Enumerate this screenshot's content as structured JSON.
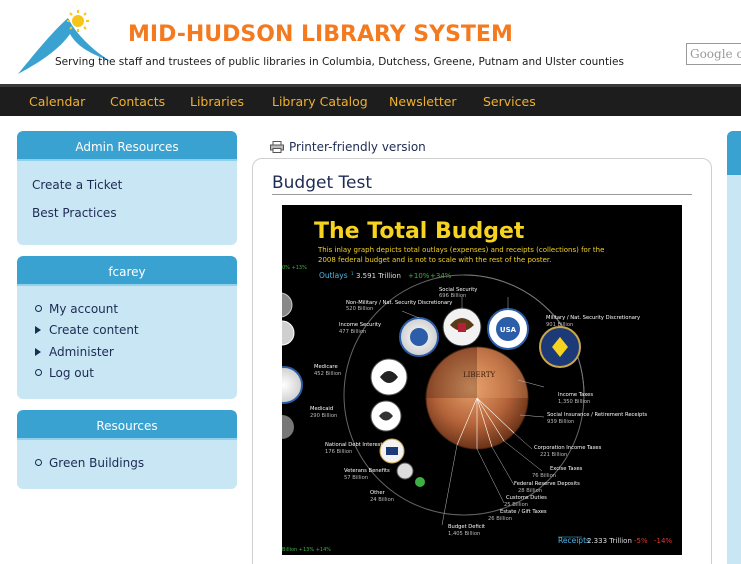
{
  "header": {
    "site_name": "MID-HUDSON LIBRARY SYSTEM",
    "slogan": "Serving the staff and trustees of public libraries in Columbia, Dutchess, Greene, Putnam and Ulster counties",
    "search_placeholder": "Google c",
    "logo_icon": "mountain-sun-logo"
  },
  "nav": {
    "items": [
      "Calendar",
      "Contacts",
      "Libraries",
      "Library Catalog",
      "Newsletter",
      "Services"
    ]
  },
  "sidebar": {
    "admin": {
      "title": "Admin Resources",
      "links": [
        "Create a Ticket",
        "Best Practices"
      ]
    },
    "user": {
      "title": "fcarey",
      "items": [
        "My account",
        "Create content",
        "Administer",
        "Log out"
      ]
    },
    "resources": {
      "title": "Resources",
      "items": [
        "Green Buildings"
      ]
    }
  },
  "content": {
    "printer_label": "Printer-friendly version",
    "title": "Budget Test",
    "infographic": {
      "heading": "The Total Budget",
      "intro_1": "This inlay graph depicts total outlays (expenses) and receipts (collections) for the",
      "intro_2": "2008 federal budget and is not to scale with the rest of the poster.",
      "outlays": {
        "label": "Outlays",
        "sup": "1",
        "amount": "3.591 Trillion",
        "change1": "+10%",
        "change2": "+34%"
      },
      "receipts": {
        "label": "Receipts",
        "amount": "2.333 Trillion",
        "change1": "-5%",
        "change2": "-14%"
      },
      "left_categories": [
        {
          "name": "Social Security",
          "sup": "2",
          "detail": "696 Billion",
          "ch": "+7% +10%"
        },
        {
          "name": "Non-Military / Nat. Security Discretionary",
          "detail": "520 Billion",
          "ch": "+6% +65%"
        },
        {
          "name": "Income Security",
          "detail": "477 Billion",
          "ch": "+14% +21%"
        },
        {
          "name": "Medicare",
          "detail": "452 Billion",
          "ch": "+8% +10%"
        },
        {
          "name": "Medicaid",
          "detail": "290 Billion",
          "ch": "+22% +80%"
        },
        {
          "name": "National Debt Interest",
          "detail": "176 Billion",
          "ch": "-15% -34%"
        },
        {
          "name": "Veterans Benefits",
          "detail": "57 Billion",
          "ch": "+13% +7%"
        },
        {
          "name": "Other",
          "detail": "24 Billion",
          "ch": ""
        },
        {
          "name": "Budget Deficit",
          "sup": "3",
          "detail": "1,405 Billion",
          "ch": "+109% +352%"
        }
      ],
      "right_categories": [
        {
          "name": "Military / Nat. Security Discretionary",
          "detail": "901 Billion",
          "ch": "+1% +1%"
        },
        {
          "name": "Income Taxes",
          "detail": "1,350 Billion",
          "ch": "-4% -4%"
        },
        {
          "name": "Social Insurance / Retirement Receipts",
          "detail": "939 Billion",
          "ch": "+2% +0%"
        },
        {
          "name": "Corporation Income Taxes",
          "detail": "221 Billion",
          "ch": "-14% -42%"
        },
        {
          "name": "Excise Taxes",
          "detail": "76 Billion",
          "ch": "+7% -1%"
        },
        {
          "name": "Federal Reserve Deposits",
          "detail": "28 Billion",
          "ch": "-9% -26%"
        },
        {
          "name": "Customs Duties",
          "detail": "25 Billion",
          "ch": "-5% -14%"
        },
        {
          "name": "Estate / Gift Taxes",
          "detail": "26 Billion",
          "ch": "-15% -10%"
        }
      ],
      "left_edge_text_top": "0% +13%",
      "left_edge_text_bottom": "Billion +13% +14%",
      "colors": {
        "heading": "#f5d320",
        "positive": "#3cb043",
        "negative": "#e23b2e",
        "outlays": "#4fb6e8"
      }
    }
  },
  "colors": {
    "brand_orange": "#f47a1f",
    "nav_bg": "#1d1d1d",
    "nav_text": "#f0b030",
    "block_header": "#3aa2d1",
    "block_body": "#c8e6f3",
    "link": "#1e2b53"
  }
}
